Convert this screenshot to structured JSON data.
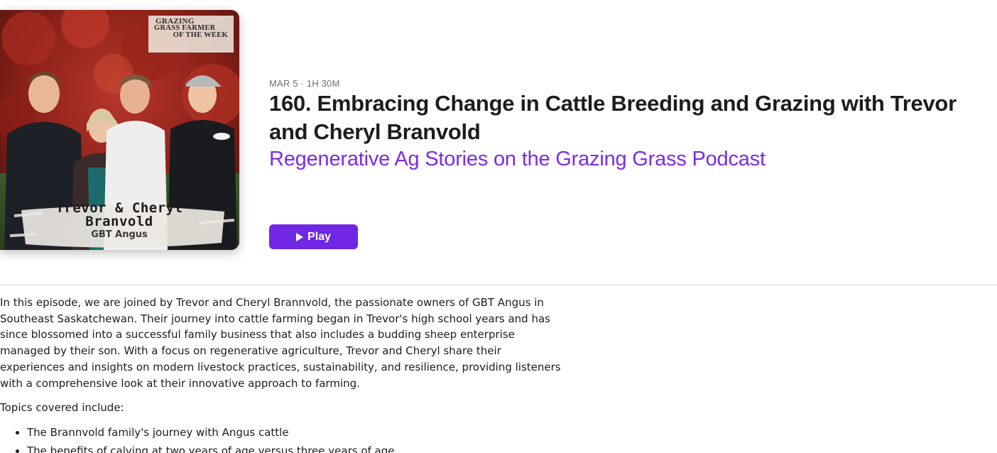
{
  "artwork": {
    "badge_line1": "Grazing",
    "badge_line2": "Grass Farmer",
    "badge_line3": "of the Week",
    "caption_names_line1": "Trevor & Cheryl",
    "caption_names_line2": "Branvold",
    "caption_farm": "GBT Angus"
  },
  "episode": {
    "meta": "MAR 5 · 1H 30M",
    "title": "160. Embracing Change in Cattle Breeding and Grazing with Trevor and Cheryl Branvold",
    "show_name": "Regenerative Ag Stories on the Grazing Grass Podcast",
    "play_label": "Play"
  },
  "description": {
    "paragraph": "In this episode, we are joined by Trevor and Cheryl Brannvold, the passionate owners of GBT Angus in Southeast Saskatchewan. Their journey into cattle farming began in Trevor's high school years and has since blossomed into a successful family business that also includes a budding sheep enterprise managed by their son. With a focus on regenerative agriculture, Trevor and Cheryl share their experiences and insights on modern livestock practices, sustainability, and resilience, providing listeners with a comprehensive look at their innovative approach to farming.",
    "topics_heading": "Topics covered include:",
    "topics": [
      "The Brannvold family's journey with Angus cattle",
      "The benefits of calving at two years of age versus three years of age"
    ]
  },
  "colors": {
    "accent": "#7028e4",
    "show_link": "#7d2ae8",
    "meta_text": "#6e6e73"
  }
}
